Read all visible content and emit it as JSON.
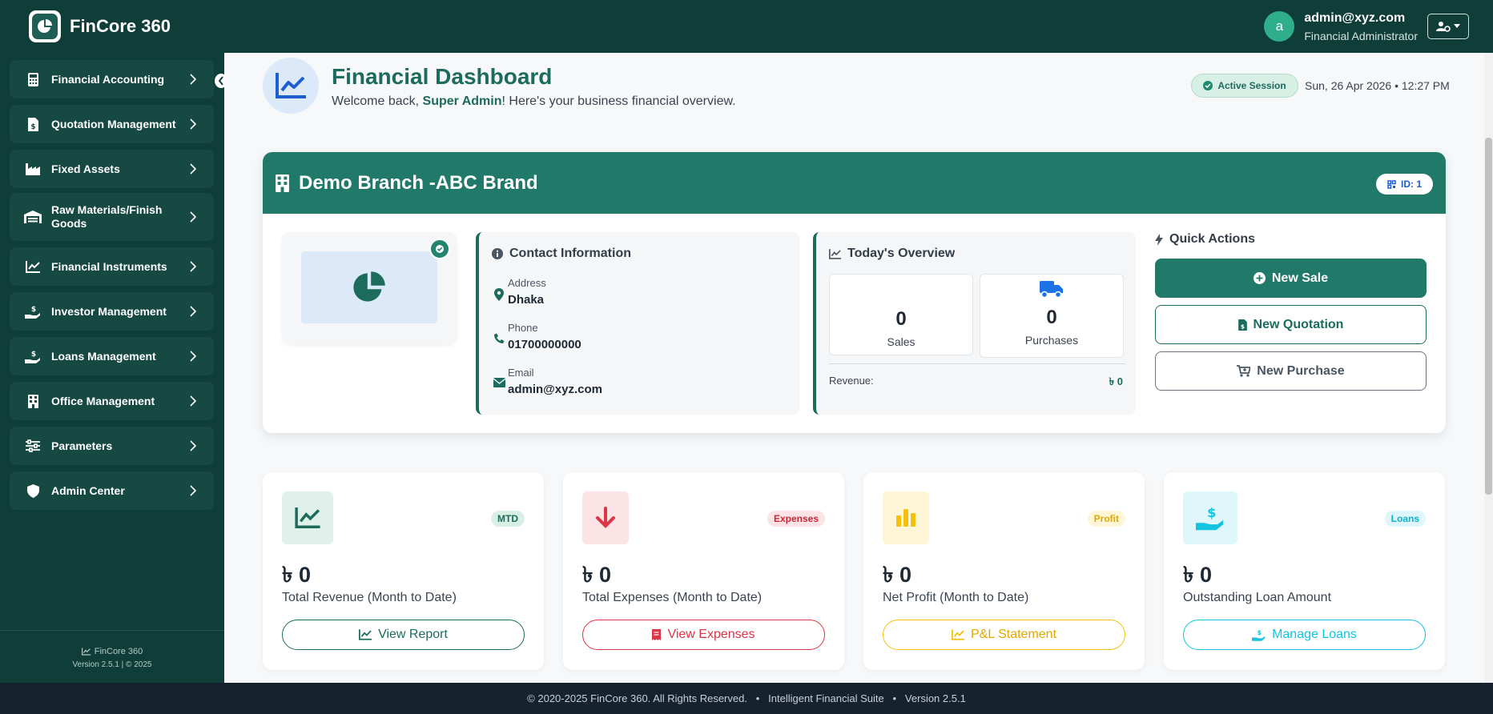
{
  "header": {
    "brand_name": "FinCore 360",
    "user_initial": "a",
    "user_email": "admin@xyz.com",
    "user_role": "Financial Administrator"
  },
  "sidebar": {
    "items": [
      {
        "label": "Financial Accounting",
        "icon": "calculator-icon"
      },
      {
        "label": "Quotation Management",
        "icon": "invoice-dollar-icon"
      },
      {
        "label": "Fixed Assets",
        "icon": "industry-icon"
      },
      {
        "label": "Raw Materials/Finish Goods",
        "icon": "warehouse-icon"
      },
      {
        "label": "Financial Instruments",
        "icon": "chart-line-icon"
      },
      {
        "label": "Investor Management",
        "icon": "hand-holding-dollar-icon"
      },
      {
        "label": "Loans Management",
        "icon": "hand-holding-dollar-icon"
      },
      {
        "label": "Office Management",
        "icon": "building-icon"
      },
      {
        "label": "Parameters",
        "icon": "sliders-icon"
      },
      {
        "label": "Admin Center",
        "icon": "shield-icon"
      }
    ],
    "footer_name": "FinCore 360",
    "footer_version": "Version 2.5.1 | © 2025"
  },
  "dashboard": {
    "title": "Financial Dashboard",
    "welcome_prefix": "Welcome back, ",
    "welcome_name": "Super Admin",
    "welcome_suffix": "! Here's your business financial overview.",
    "session_label": "Active Session",
    "datetime": "Sun, 26 Apr 2026 • 12:27 PM"
  },
  "branch": {
    "name": "Demo Branch -ABC Brand",
    "id_label": "ID: 1",
    "contact": {
      "title": "Contact Information",
      "address_label": "Address",
      "address": "Dhaka",
      "phone_label": "Phone",
      "phone": "01700000000",
      "email_label": "Email",
      "email": "admin@xyz.com"
    },
    "overview": {
      "title": "Today's Overview",
      "sales_value": "0",
      "sales_label": "Sales",
      "purchases_value": "0",
      "purchases_label": "Purchases",
      "revenue_label": "Revenue:",
      "revenue_value": "৳ 0"
    },
    "quick_actions": {
      "title": "Quick Actions",
      "new_sale": "New Sale",
      "new_quotation": "New Quotation",
      "new_purchase": "New Purchase"
    }
  },
  "kpis": [
    {
      "badge": "MTD",
      "value": "৳ 0",
      "label": "Total Revenue (Month to Date)",
      "button": "View Report",
      "color": "#1d6b5d"
    },
    {
      "badge": "Expenses",
      "value": "৳ 0",
      "label": "Total Expenses (Month to Date)",
      "button": "View Expenses",
      "color": "#dc3545"
    },
    {
      "badge": "Profit",
      "value": "৳ 0",
      "label": "Net Profit (Month to Date)",
      "button": "P&L Statement",
      "color": "#f4c20d"
    },
    {
      "badge": "Loans",
      "value": "৳ 0",
      "label": "Outstanding Loan Amount",
      "button": "Manage Loans",
      "color": "#13c3e0"
    }
  ],
  "footer": {
    "text": "© 2020-2025 FinCore 360. All Rights Reserved.   •   Intelligent Financial Suite   •   Version 2.5.1"
  }
}
